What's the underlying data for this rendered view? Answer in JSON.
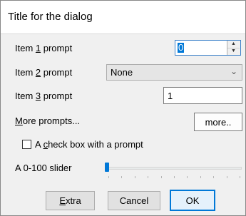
{
  "window": {
    "title": "Title for the dialog"
  },
  "items": {
    "item1": {
      "label_pre": "Item ",
      "label_ul": "1",
      "label_post": " prompt",
      "value": "0"
    },
    "item2": {
      "label_pre": "Item ",
      "label_ul": "2",
      "label_post": " prompt",
      "selected": "None"
    },
    "item3": {
      "label_pre": "Item ",
      "label_ul": "3",
      "label_post": " prompt",
      "value": "1"
    }
  },
  "more": {
    "label_ul": "M",
    "label_post": "ore prompts...",
    "button_label": "more.."
  },
  "checkbox": {
    "label_pre": "A ",
    "label_ul": "c",
    "label_post": "heck box with a prompt",
    "checked": false
  },
  "slider": {
    "label": "A 0-100 slider",
    "min": 0,
    "max": 100,
    "value": 0
  },
  "buttons": {
    "extra_ul": "E",
    "extra_post": "xtra",
    "cancel": "Cancel",
    "ok": "OK"
  },
  "colors": {
    "accent": "#0078d7",
    "body_bg": "#f0f0f0"
  }
}
